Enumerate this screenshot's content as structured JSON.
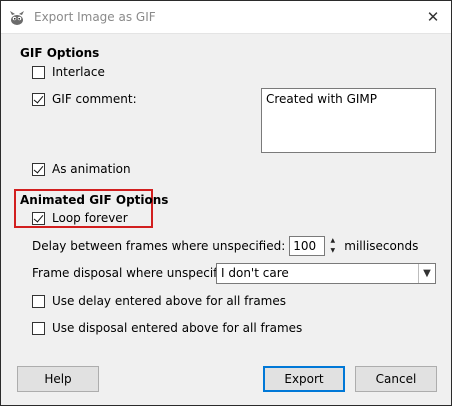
{
  "window": {
    "title": "Export Image as GIF",
    "close_glyph": "✕"
  },
  "gif_options": {
    "title": "GIF Options",
    "interlace": {
      "label": "Interlace",
      "checked": false
    },
    "gif_comment": {
      "label": "GIF comment:",
      "checked": true,
      "value": "Created with GIMP"
    },
    "as_animation": {
      "label": "As animation",
      "checked": true
    }
  },
  "animated_options": {
    "title": "Animated GIF Options",
    "loop_forever": {
      "label": "Loop forever",
      "checked": true
    },
    "delay": {
      "label": "Delay between frames where unspecified:",
      "value": "100",
      "unit": "milliseconds"
    },
    "disposal": {
      "label": "Frame disposal where unspecified:",
      "selected": "I don't care"
    },
    "use_delay": {
      "label": "Use delay entered above for all frames",
      "checked": false
    },
    "use_disposal": {
      "label": "Use disposal entered above for all frames",
      "checked": false
    }
  },
  "buttons": {
    "help": "Help",
    "export": "Export",
    "cancel": "Cancel"
  },
  "accent_color": "#0078d7",
  "highlight_color": "#d21f1f"
}
